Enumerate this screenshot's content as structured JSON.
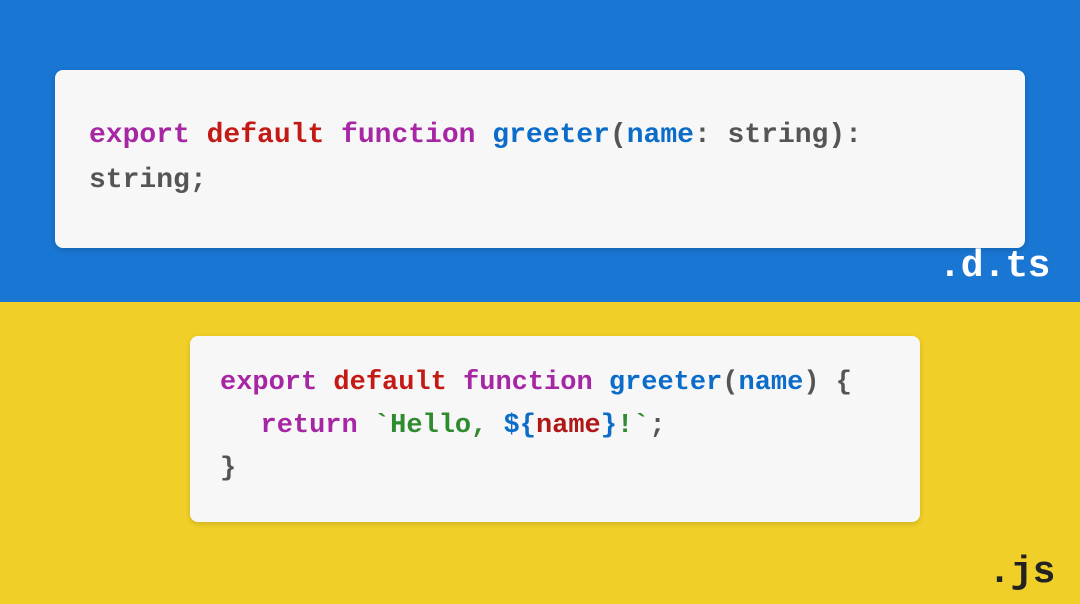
{
  "top": {
    "label": ".d.ts",
    "code": {
      "t1": "export ",
      "t2": "default ",
      "t3": "function ",
      "t4": "greeter",
      "t5": "(",
      "t6": "name",
      "t7": ": ",
      "t8": "string",
      "t9": "): ",
      "t10": "string",
      "t11": ";"
    }
  },
  "bottom": {
    "label": ".js",
    "code": {
      "l1": {
        "t1": "export ",
        "t2": "default ",
        "t3": "function ",
        "t4": "greeter",
        "t5": "(",
        "t6": "name",
        "t7": ") {"
      },
      "l2": {
        "t1": "return ",
        "t2": "`Hello, ",
        "t3": "${",
        "t4": "name",
        "t5": "}",
        "t6": "!`",
        "t7": ";"
      },
      "l3": {
        "t1": "}"
      }
    }
  }
}
